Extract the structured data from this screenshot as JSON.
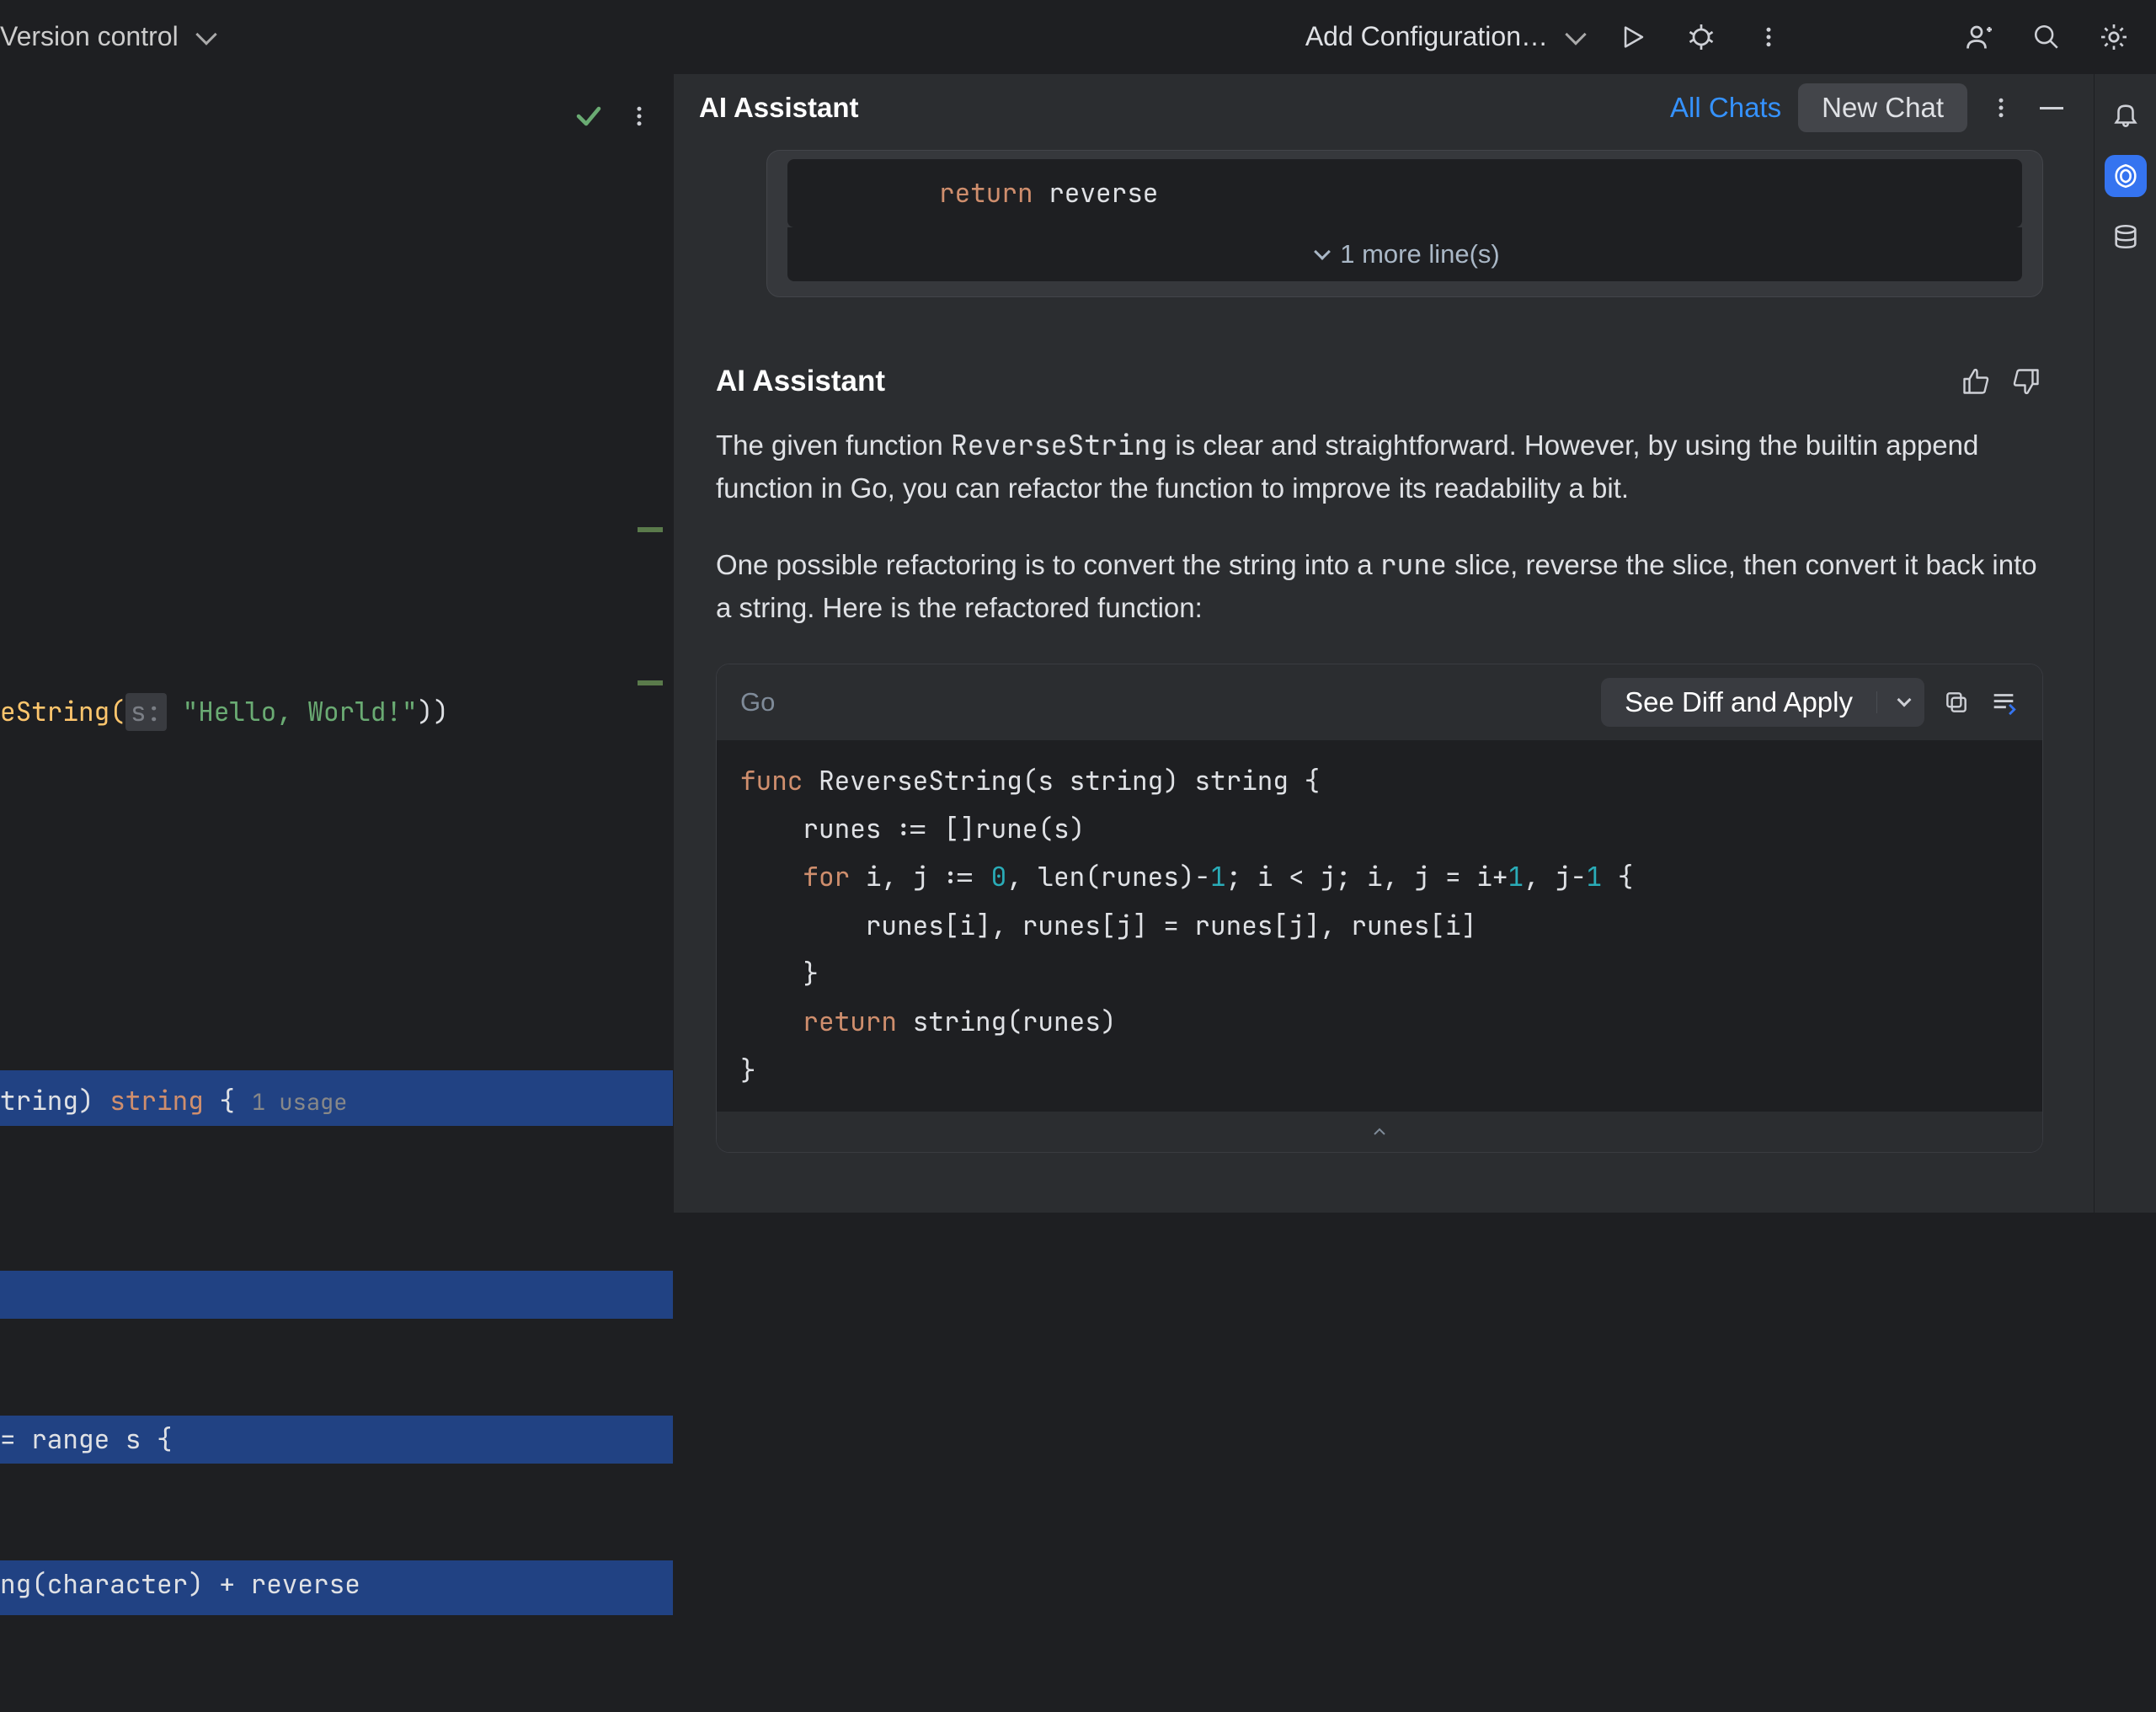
{
  "topbar": {
    "vcs_label": "Version control",
    "config_label": "Add Configuration…"
  },
  "editor": {
    "call_prefix": "eString(",
    "call_param_hint": "s:",
    "call_arg": "\"Hello, World!\"",
    "call_suffix": "))",
    "decl_prefix": "tring) ",
    "decl_type": "string",
    "decl_brace": " {",
    "usage_text": "1 usage",
    "range_line": "= range s {",
    "concat_line": "ng(character) + reverse"
  },
  "assistant": {
    "panel_title": "AI Assistant",
    "all_chats": "All Chats",
    "new_chat": "New Chat",
    "user_return_kw": "return",
    "user_return_var": " reverse",
    "more_lines": "1 more line(s)",
    "ai_name": "AI Assistant",
    "para1_a": "The given function ",
    "para1_code": "ReverseString",
    "para1_b": " is clear and straightforward. However, by using the builtin append function in Go, you can refactor the function to improve its readability a bit.",
    "para2_a": "One possible refactoring is to convert the string into a ",
    "para2_code": "rune",
    "para2_b": " slice, reverse the slice, then convert it back into a string. Here is the refactored function:",
    "code_lang": "Go",
    "apply_label": "See Diff and Apply",
    "code_lines": {
      "l1": {
        "kw": "func",
        "rest": " ReverseString(s string) string {"
      },
      "l2": "    runes := []rune(s)",
      "l3": {
        "indent": "    ",
        "kw": "for",
        "a": " i, j := ",
        "n1": "0",
        "b": ", len(runes)-",
        "n2": "1",
        "c": "; i < j; i, j = i+",
        "n3": "1",
        "d": ", j-",
        "n4": "1",
        "e": " {"
      },
      "l4": "        runes[i], runes[j] = runes[j], runes[i]",
      "l5": "    }",
      "l6": {
        "indent": "    ",
        "kw": "return",
        "rest": " string(runes)"
      },
      "l7": "}"
    }
  },
  "icons": {
    "run": "run-icon",
    "debug": "debug-icon",
    "more": "more-vertical-icon",
    "user": "user-plus-icon",
    "search": "search-icon",
    "settings": "gear-icon",
    "bell": "bell-icon",
    "ai": "ai-swirl-icon",
    "db": "database-icon",
    "check": "checkmark-icon",
    "thumbs_up": "thumbs-up-icon",
    "thumbs_down": "thumbs-down-icon",
    "copy": "copy-icon",
    "insert": "insert-icon",
    "chevron_down": "chevron-down-icon",
    "chevron_up": "chevron-up-icon",
    "minimize": "minimize-icon"
  },
  "colors": {
    "accent": "#3574f0",
    "kw": "#cf8e6d",
    "num": "#2aacb8",
    "str": "#6aab73"
  }
}
